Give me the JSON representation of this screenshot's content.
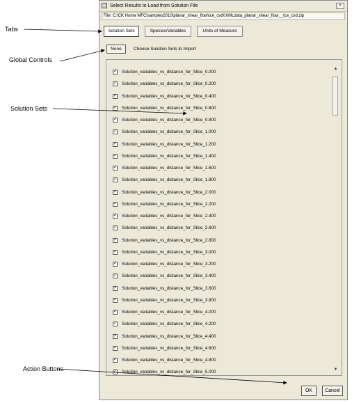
{
  "window": {
    "title": "Select  Results to Load from Solution File",
    "close_glyph": "×"
  },
  "file_bar": {
    "text": "File:  C:\\CK Home MFC\\samples2010\\planar_shear_flow\\tce_cvd\\\\XMLdata_planar_shear_flow__tce_cvd.zip"
  },
  "tabs": [
    {
      "label": "Solution Sets",
      "active": true
    },
    {
      "label": "Species/Variables",
      "active": false
    },
    {
      "label": "Units of Measure",
      "active": false
    }
  ],
  "global_controls": {
    "none_label": "None",
    "choose_label": "Choose  Solution Sets to Import"
  },
  "solution_sets": [
    {
      "label": "Solution_variables_vs_distance_for_Slice_0.000",
      "checked": true
    },
    {
      "label": "Solution_variables_vs_distance_for_Slice_0.200",
      "checked": true
    },
    {
      "label": "Solution_variables_vs_distance_for_Slice_0.400",
      "checked": true
    },
    {
      "label": "Solution_variables_vs_distance_for_Slice_0.600",
      "checked": true
    },
    {
      "label": "Solution_variables_vs_distance_for_Slice_0.800",
      "checked": true
    },
    {
      "label": "Solution_variables_vs_distance_for_Slice_1.000",
      "checked": true
    },
    {
      "label": "Solution_variables_vs_distance_for_Slice_1.200",
      "checked": true
    },
    {
      "label": "Solution_variables_vs_distance_for_Slice_1.400",
      "checked": true
    },
    {
      "label": "Solution_variables_vs_distance_for_Slice_1.600",
      "checked": true
    },
    {
      "label": "Solution_variables_vs_distance_for_Slice_1.800",
      "checked": true
    },
    {
      "label": "Solution_variables_vs_distance_for_Slice_2.000",
      "checked": true
    },
    {
      "label": "Solution_variables_vs_distance_for_Slice_2.200",
      "checked": true
    },
    {
      "label": "Solution_variables_vs_distance_for_Slice_2.400",
      "checked": true
    },
    {
      "label": "Solution_variables_vs_distance_for_Slice_2.600",
      "checked": true
    },
    {
      "label": "Solution_variables_vs_distance_for_Slice_2.800",
      "checked": true
    },
    {
      "label": "Solution_variables_vs_distance_for_Slice_3.000",
      "checked": true
    },
    {
      "label": "Solution_variables_vs_distance_for_Slice_3.200",
      "checked": true
    },
    {
      "label": "Solution_variables_vs_distance_for_Slice_3.400",
      "checked": true
    },
    {
      "label": "Solution_variables_vs_distance_for_Slice_3.600",
      "checked": true
    },
    {
      "label": "Solution_variables_vs_distance_for_Slice_3.800",
      "checked": true
    },
    {
      "label": "Solution_variables_vs_distance_for_Slice_4.000",
      "checked": true
    },
    {
      "label": "Solution_variables_vs_distance_for_Slice_4.200",
      "checked": true
    },
    {
      "label": "Solution_variables_vs_distance_for_Slice_4.400",
      "checked": true
    },
    {
      "label": "Solution_variables_vs_distance_for_Slice_4.600",
      "checked": true
    },
    {
      "label": "Solution_variables_vs_distance_for_Slice_4.800",
      "checked": true
    },
    {
      "label": "Solution_variables_vs_distance_for_Slice_5.000",
      "checked": true
    }
  ],
  "scrollbar": {
    "up_glyph": "▲",
    "down_glyph": "▼"
  },
  "action_buttons": {
    "ok_label": "OK",
    "cancel_label": "Cancel"
  },
  "callouts": {
    "tabs": "Tabs",
    "global_controls": "Global Controls",
    "solution_sets": "Solution Sets",
    "action_buttons": "Action Buttons"
  }
}
